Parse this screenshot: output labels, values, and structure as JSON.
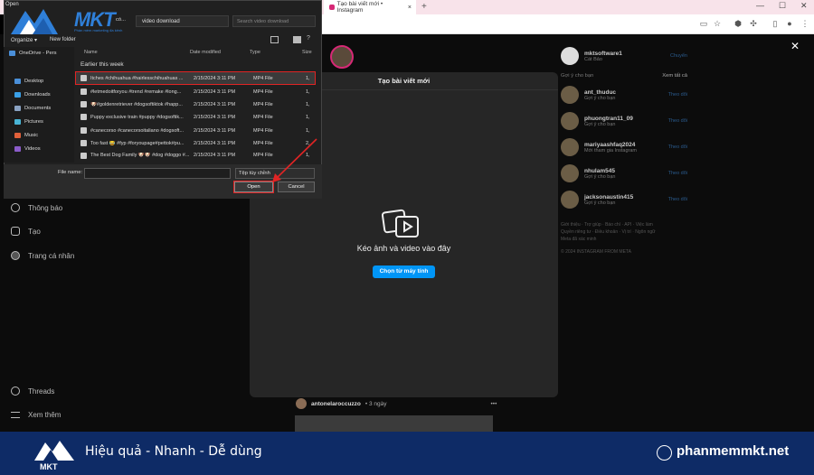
{
  "browser": {
    "tab_title": "Tạo bài viết mới • Instagram",
    "tab_close": "×",
    "new_tab": "+",
    "min": "—",
    "max": "☐",
    "close": "✕"
  },
  "instagram": {
    "sidebar": [
      {
        "label": "Thông báo",
        "icon": "heart-icon"
      },
      {
        "label": "Tạo",
        "icon": "plus-icon"
      },
      {
        "label": "Trang cá nhân",
        "icon": "profile-icon"
      },
      {
        "label": "Threads",
        "icon": "threads-icon"
      },
      {
        "label": "Xem thêm",
        "icon": "menu-icon"
      }
    ],
    "account": {
      "username": "mktsoftware1",
      "name": "Cát Bảo",
      "action": "Chuyển"
    },
    "suggest_header": "Gợi ý cho bạn",
    "see_all": "Xem tất cả",
    "suggestions": [
      {
        "username": "ant_thuduc",
        "sub": "Gợi ý cho bạn",
        "action": "Theo dõi"
      },
      {
        "username": "phuongtran11_09",
        "sub": "Gợi ý cho bạn",
        "action": "Theo dõi"
      },
      {
        "username": "mariyaashfaq2024",
        "sub": "Mới tham gia Instagram",
        "action": "Theo dõi"
      },
      {
        "username": "nhulam545",
        "sub": "Gợi ý cho bạn",
        "action": "Theo dõi"
      },
      {
        "username": "jacksonaustin415",
        "sub": "Gợi ý cho bạn",
        "action": "Theo dõi"
      }
    ],
    "footer_lines": [
      "Giới thiệu · Trợ giúp · Báo chí · API · Việc làm",
      "Quyền riêng tư · Điều khoản · Vị trí · Ngôn ngữ",
      "Meta đã xác minh",
      "© 2024 INSTAGRAM FROM META"
    ],
    "post_user": "antonelaroccuzzo",
    "post_time": "• 3 ngày",
    "post_more": "•••"
  },
  "modal": {
    "title": "Tạo bài viết mới",
    "drop_text": "Kéo ảnh và video vào đây",
    "button": "Chọn từ máy tính",
    "close": "✕"
  },
  "dialog": {
    "title": "Open",
    "path": "video download",
    "path_prefix": "có...",
    "search_placeholder": "Search video download",
    "organize": "Organize ▾",
    "new_folder": "New folder",
    "nav": [
      {
        "label": "OneDrive - Pers"
      },
      {
        "label": "Desktop"
      },
      {
        "label": "Downloads"
      },
      {
        "label": "Documents"
      },
      {
        "label": "Pictures"
      },
      {
        "label": "Music"
      },
      {
        "label": "Videos"
      }
    ],
    "columns": {
      "name": "Name",
      "date": "Date modified",
      "type": "Type",
      "size": "Size"
    },
    "group": "Earlier this week",
    "files": [
      {
        "name": "Itches #chihuahua #hairlesschihuahuas ...",
        "date": "2/15/2024 3:11 PM",
        "type": "MP4 File",
        "size": "1,"
      },
      {
        "name": "#letmedoitforyou #trend #remake #long...",
        "date": "2/15/2024 3:11 PM",
        "type": "MP4 File",
        "size": "1,"
      },
      {
        "name": "🐶#goldenretriever #dogsoftiktok #happ...",
        "date": "2/15/2024 3:11 PM",
        "type": "MP4 File",
        "size": "1,"
      },
      {
        "name": "Puppy exclusive train #puppy #dogsoftik...",
        "date": "2/15/2024 3:11 PM",
        "type": "MP4 File",
        "size": "1,"
      },
      {
        "name": "#canecorso #canecorsoitaliano #dogsoft...",
        "date": "2/15/2024 3:11 PM",
        "type": "MP4 File",
        "size": "1,"
      },
      {
        "name": "Too fast 😂 #fyp #foryoupage#pettok#pu...",
        "date": "2/15/2024 3:11 PM",
        "type": "MP4 File",
        "size": "2,"
      },
      {
        "name": "The Best Dog Family 🐶🐶 #dog #doggo #...",
        "date": "2/15/2024 3:11 PM",
        "type": "MP4 File",
        "size": "1,"
      }
    ],
    "file_name_label": "File name:",
    "file_type": "Tệp tùy chỉnh",
    "open": "Open",
    "cancel": "Cancel"
  },
  "brand": {
    "logo": "MKT",
    "logo_sub": "Phần mềm marketing đa kênh",
    "slogan": "Hiệu quả - Nhanh - Dễ dùng",
    "website": "phanmemmkt.net"
  }
}
